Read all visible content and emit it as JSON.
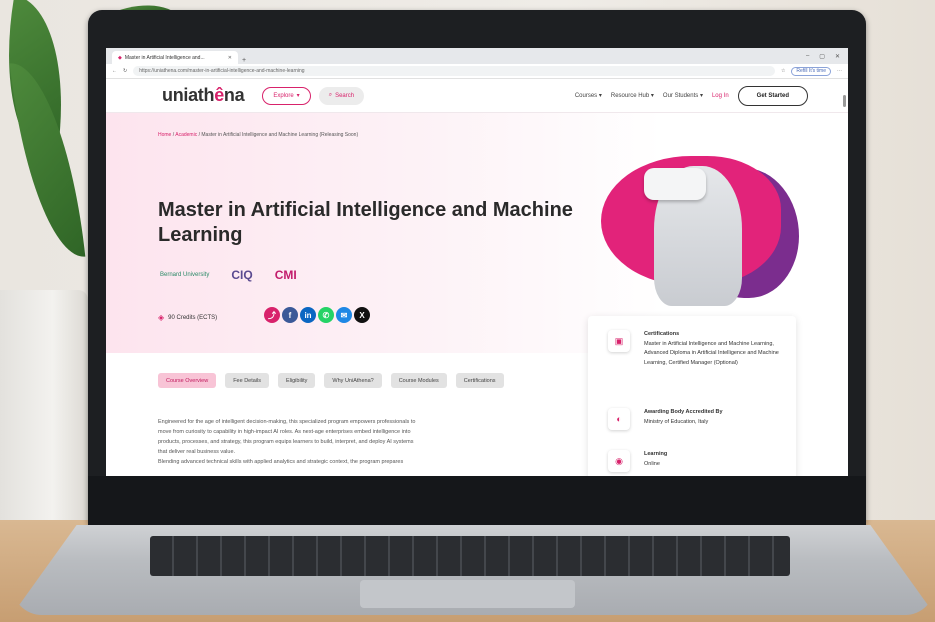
{
  "browser": {
    "tab_title": "Master in Artificial Intelligence and...",
    "url": "https://uniathena.com/master-in-artificial-intelligence-and-machine-learning",
    "profile_chip": "Refill It's time",
    "window_controls": [
      "–",
      "▢",
      "✕"
    ]
  },
  "site": {
    "logo_main": "uniath",
    "logo_accent": "ê",
    "logo_tail": "na",
    "explore_label": "Explore",
    "search_label": "Search",
    "nav": [
      "Courses",
      "Resource Hub",
      "Our Students"
    ],
    "login_label": "Log In",
    "get_started_label": "Get Started"
  },
  "hero": {
    "breadcrumb_home": "Home",
    "breadcrumb_academic": "Academic",
    "breadcrumb_current": "Master in Artificial Intelligence and Machine Learning (Releasing Soon)",
    "title": "Master in Artificial Intelligence and Machine Learning",
    "accreditors": [
      "Bernard University",
      "CIQ",
      "CMI"
    ],
    "credits": "90 Credits (ECTS)",
    "share_icons": [
      "share-icon",
      "facebook-icon",
      "linkedin-icon",
      "whatsapp-icon",
      "email-icon",
      "x-icon"
    ],
    "colors": {
      "brand": "#d8226b",
      "purple": "#7b2d8e"
    }
  },
  "course_tabs": [
    "Course Overview",
    "Fee Details",
    "Eligibility",
    "Why UniAthena?",
    "Course Modules",
    "Certifications"
  ],
  "description": [
    "Engineered for the age of intelligent decision-making, this specialized program empowers professionals to",
    "move from curiosity to capability in high-impact AI roles. As next-age enterprises embed intelligence into",
    "products, processes, and strategy, this program equips learners to build, interpret, and deploy AI systems",
    "that deliver real business value.",
    "Blending advanced technical skills with applied analytics and strategic context, the program prepares"
  ],
  "info_card": {
    "certifications_label": "Certifications",
    "certifications_value": "Master in Artificial Intelligence and Machine Learning, Advanced Diploma in Artificial Intelligence and Machine Learning, Certified Manager (Optional)",
    "awarding_label": "Awarding Body Accredited By",
    "awarding_value": "Ministry of Education, Italy",
    "learning_label": "Learning",
    "learning_value": "Online"
  }
}
